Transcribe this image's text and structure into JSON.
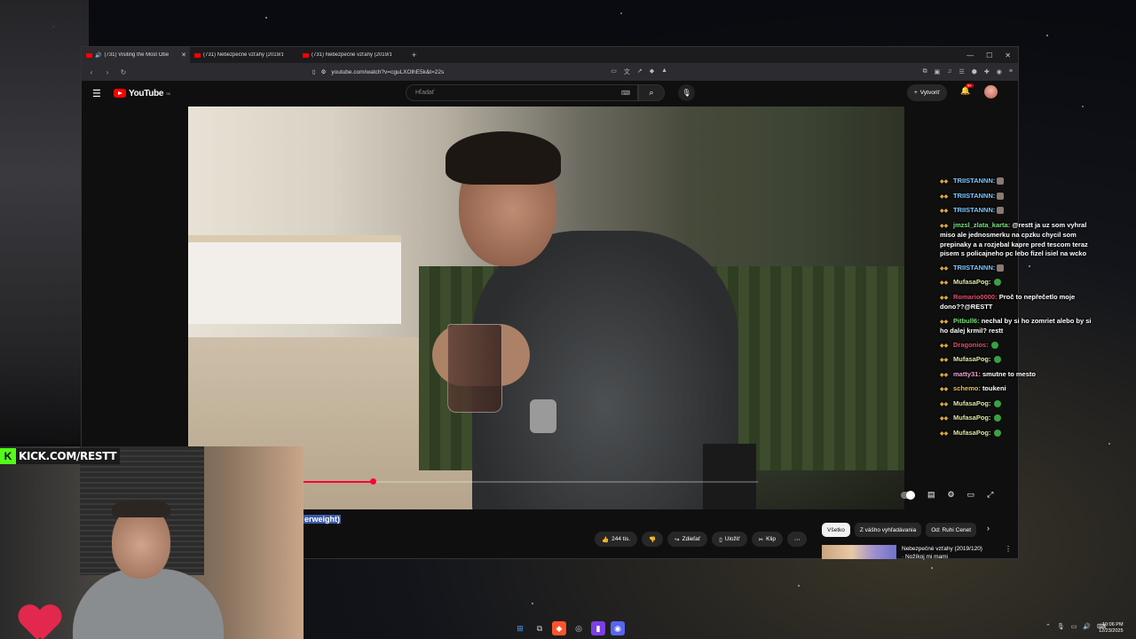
{
  "browser": {
    "tabs": [
      {
        "label": "(731) Visiting the Most Obe",
        "active": true
      },
      {
        "label": "(731) Nebezpečné vzťahy (2019/120",
        "active": false
      },
      {
        "label": "(731) Nebezpečné vzťahy (2019/12",
        "active": false
      }
    ],
    "new_tab": "+",
    "url": "youtube.com/watch?v=cguLXOlhE5k&t=22s"
  },
  "youtube": {
    "logo": "YouTube",
    "logo_country": "SK",
    "search_placeholder": "Hľadať",
    "create_label": "Vytvoriť",
    "notification_count": "9+"
  },
  "player": {
    "progress_fraction": 0.155
  },
  "video_title_fragment": "erweight)",
  "actions": {
    "like_count": "244 tis.",
    "share": "Zdieľať",
    "save": "Uložiť",
    "clip": "Klip",
    "more": "⋯"
  },
  "chips": [
    "Všetko",
    "Z vášho vyhľadávania",
    "Od: Ruhi Cenet"
  ],
  "recommendation": {
    "title": "Nebezpečné vzťahy (2019/120)",
    "subtitle": "· Nožíkoj mi mami"
  },
  "chat": [
    {
      "user": "TRIISTANNN:",
      "text": "",
      "color": "#7fc8ff",
      "emote": "face"
    },
    {
      "user": "TRIISTANNN:",
      "text": "",
      "color": "#7fc8ff",
      "emote": "face"
    },
    {
      "user": "TRIISTANNN:",
      "text": "",
      "color": "#7fc8ff",
      "emote": "face"
    },
    {
      "user": "jmzsl_zlata_karta:",
      "text": "@restt ja uz som vyhral miso ale jednosmerku na cpzku chycil som prepinaky a a rozjebal kapre pred tescom teraz pisem s policajneho pc lebo fizel isiel na wcko",
      "color": "#76e07b",
      "emote": ""
    },
    {
      "user": "TRIISTANNN:",
      "text": "",
      "color": "#7fc8ff",
      "emote": "face"
    },
    {
      "user": "MufasaPog:",
      "text": "",
      "color": "#dfe6a0",
      "emote": "pepe"
    },
    {
      "user": "Romario0000:",
      "text": "Proč to nepřečetlo moje dono??@RESTT",
      "color": "#e0506a",
      "emote": ""
    },
    {
      "user": "Pitbull6:",
      "text": "nechal by si ho zomriet alebo by si ho dalej krmil? restt",
      "color": "#76e07b",
      "emote": ""
    },
    {
      "user": "Dragonios:",
      "text": "",
      "color": "#e0506a",
      "emote": "pepe"
    },
    {
      "user": "MufasaPog:",
      "text": "",
      "color": "#dfe6a0",
      "emote": "pepe"
    },
    {
      "user": "matty31:",
      "text": "smutne to mesto",
      "color": "#f0a0d0",
      "emote": ""
    },
    {
      "user": "schemo:",
      "text": "toukeni",
      "color": "#e8c060",
      "emote": ""
    },
    {
      "user": "MufasaPog:",
      "text": "",
      "color": "#dfe6a0",
      "emote": "pepe"
    },
    {
      "user": "MufasaPog:",
      "text": "",
      "color": "#dfe6a0",
      "emote": "pepe"
    },
    {
      "user": "MufasaPog:",
      "text": "",
      "color": "#dfe6a0",
      "emote": "pepe"
    }
  ],
  "kick": {
    "logo_letter": "K",
    "text": "KICK.COM/RESTT"
  },
  "taskbar": {
    "time": "10:06 PM",
    "date": "12/23/2025"
  }
}
